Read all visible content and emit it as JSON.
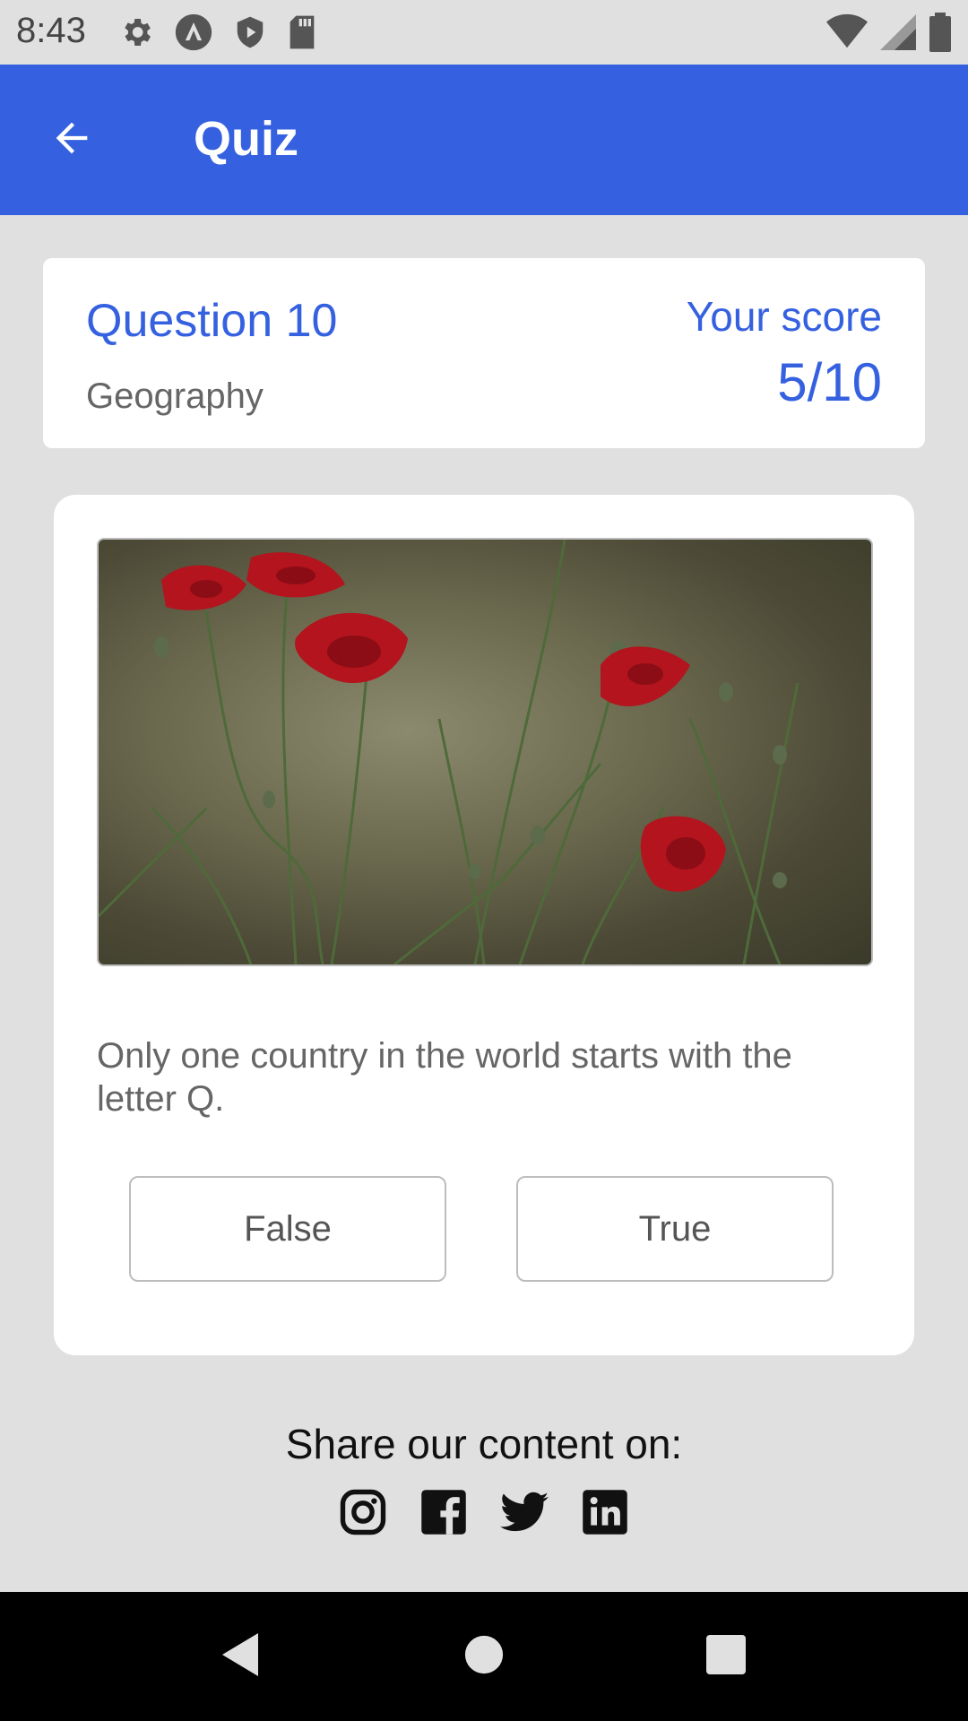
{
  "status_bar": {
    "time": "8:43",
    "left_icons": [
      "gear-icon",
      "a-circle-icon",
      "shield-icon",
      "sd-card-icon"
    ],
    "right_icons": [
      "wifi-icon",
      "signal-icon",
      "battery-icon"
    ]
  },
  "app_bar": {
    "back_icon": "arrow-left-icon",
    "title": "Quiz"
  },
  "header": {
    "question_number": "Question 10",
    "category": "Geography",
    "score_label": "Your score",
    "score_value": "5/10"
  },
  "question": {
    "image": "red-poppies-photo",
    "text": "Only one country in the world starts with the letter Q.",
    "answers": [
      {
        "label": "False"
      },
      {
        "label": "True"
      }
    ]
  },
  "share": {
    "text": "Share our content on:",
    "icons": [
      "instagram-icon",
      "facebook-icon",
      "twitter-icon",
      "linkedin-icon"
    ]
  },
  "nav_bar": {
    "icons": [
      "back-triangle-icon",
      "home-circle-icon",
      "recents-square-icon"
    ]
  },
  "colors": {
    "accent": "#3561e0",
    "background": "#e0e0e0",
    "card": "#ffffff",
    "nav": "#000000"
  }
}
